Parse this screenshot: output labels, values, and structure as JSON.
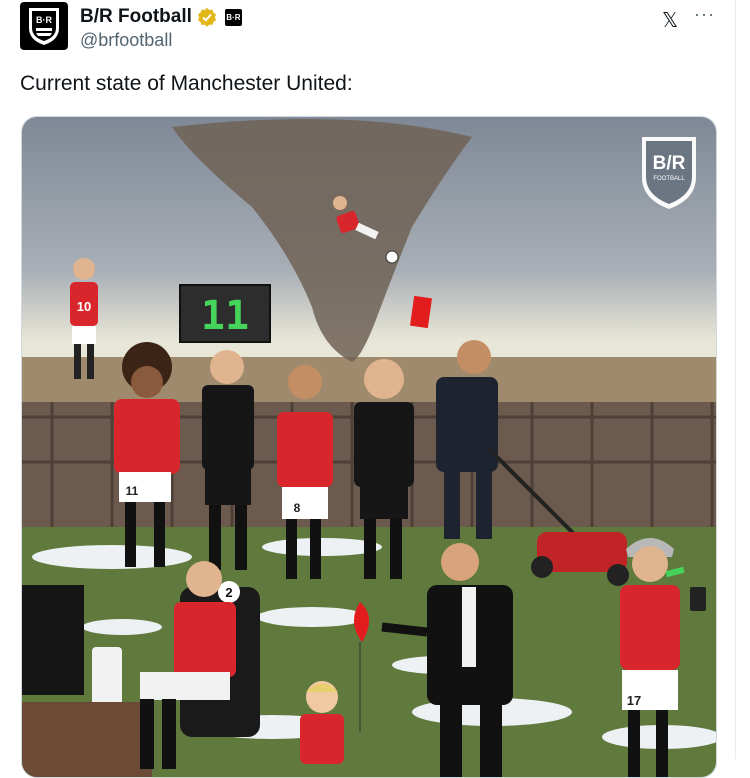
{
  "tweet": {
    "display_name": "B/R Football",
    "handle": "@brfootball",
    "verified": true,
    "text": "Current state of Manchester United:",
    "avatar_logo_text": "B·R",
    "affiliate_badge_text": "B·R"
  },
  "toolbar": {
    "x_logo": "X",
    "more_label": "···"
  },
  "media": {
    "watermark_text": "B/R",
    "watermark_subtext": "FOOTBALL",
    "sub_board_number": "11",
    "shirt_numbers": [
      "10",
      "11",
      "8",
      "2",
      "17"
    ]
  },
  "colors": {
    "verified_gold": "#e2b719",
    "kit_red": "#d9262c",
    "board_digit": "#45d35a",
    "sky": "#8e98a6"
  }
}
